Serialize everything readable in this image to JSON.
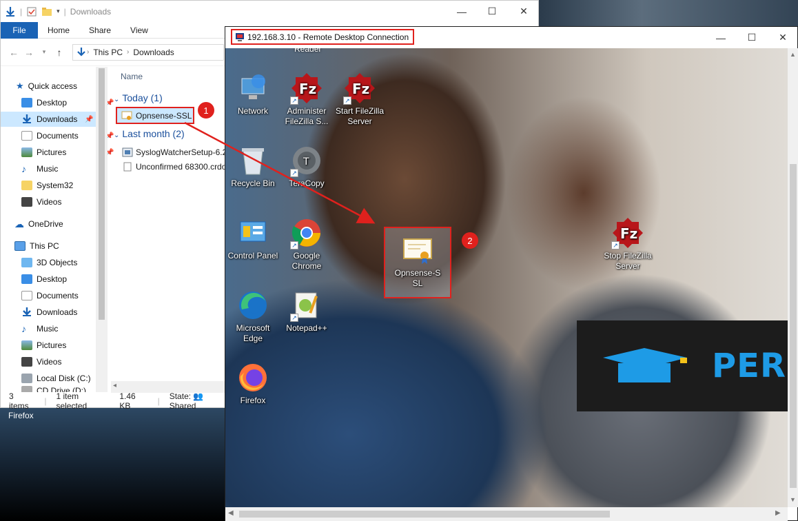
{
  "explorer": {
    "title": "Downloads",
    "ribbon_tabs": [
      "File",
      "Home",
      "Share",
      "View"
    ],
    "breadcrumb": [
      "This PC",
      "Downloads"
    ],
    "column_header": "Name",
    "nav": {
      "quick_access": "Quick access",
      "quick_items": [
        "Desktop",
        "Downloads",
        "Documents",
        "Pictures",
        "Music",
        "System32",
        "Videos"
      ],
      "onedrive": "OneDrive",
      "this_pc": "This PC",
      "pc_items": [
        "3D Objects",
        "Desktop",
        "Documents",
        "Downloads",
        "Music",
        "Pictures",
        "Videos",
        "Local Disk (C:)",
        "CD Drive (D:)"
      ]
    },
    "groups": {
      "today": "Today (1)",
      "last_month": "Last month (2)"
    },
    "files": {
      "today": [
        "Opnsense-SSL"
      ],
      "last_month": [
        "SyslogWatcherSetup-6.2",
        "Unconfirmed 68300.crdo"
      ]
    },
    "status": {
      "items": "3 items",
      "selected": "1 item selected",
      "size": "1.46 KB",
      "state_label": "State:",
      "state_value": "Shared"
    }
  },
  "outer_taskbar_label": "Firefox",
  "rdp": {
    "title": "192.168.3.10 - Remote Desktop Connection",
    "reader_label": "Reader",
    "icons": {
      "network": "Network",
      "administer_filezilla": "Administer FileZilla S...",
      "start_filezilla": "Start FileZilla Server",
      "recycle_bin": "Recycle Bin",
      "teracopy": "TeraCopy",
      "control_panel": "Control Panel",
      "google_chrome": "Google Chrome",
      "opnsense_ssl": "Opnsense-SSL",
      "stop_filezilla": "Stop FileZilla Server",
      "microsoft_edge": "Microsoft Edge",
      "notepad_pp": "Notepad++",
      "firefox": "Firefox"
    },
    "banner_text": "PER"
  },
  "badges": {
    "one": "1",
    "two": "2"
  },
  "colors": {
    "accent": "#1a63b5",
    "annotation": "#e0211d",
    "folder_group": "#1a4f9c",
    "selection": "#cce8ff"
  }
}
